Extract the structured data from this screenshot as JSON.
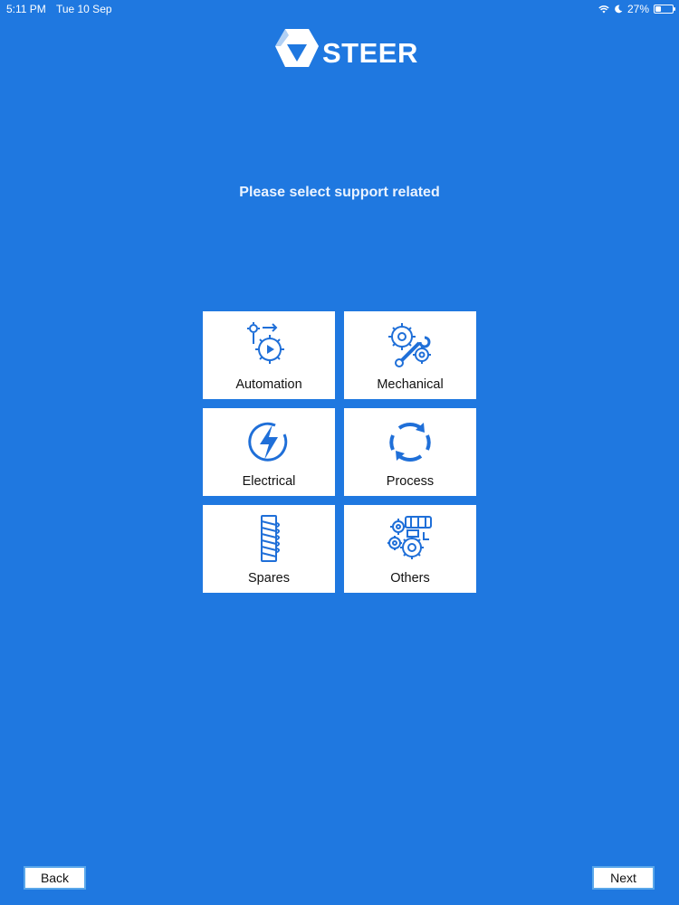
{
  "status": {
    "time": "5:11 PM",
    "date": "Tue 10 Sep",
    "battery": "27%",
    "icons": [
      "wifi-icon",
      "moon-icon",
      "battery-icon"
    ]
  },
  "brand": {
    "name": "STEER"
  },
  "prompt": "Please select support related",
  "categories": [
    {
      "label": "Automation",
      "icon": "automation-gear-icon"
    },
    {
      "label": "Mechanical",
      "icon": "gear-wrench-icon"
    },
    {
      "label": "Electrical",
      "icon": "lightning-icon"
    },
    {
      "label": "Process",
      "icon": "refresh-arrows-icon"
    },
    {
      "label": "Spares",
      "icon": "spring-icon"
    },
    {
      "label": "Others",
      "icon": "machine-gears-icon"
    }
  ],
  "nav": {
    "back_label": "Back",
    "next_label": "Next"
  },
  "colors": {
    "background": "#1f78e0",
    "icon": "#1f6fd8",
    "card": "#ffffff",
    "button_border": "#5aa7ea"
  }
}
